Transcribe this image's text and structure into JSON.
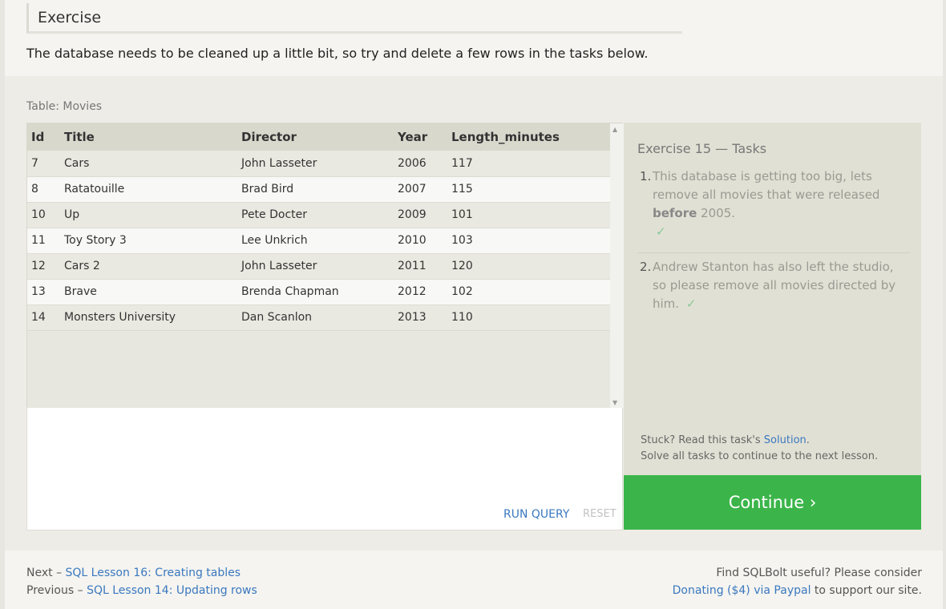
{
  "exercise": {
    "heading": "Exercise",
    "intro": "The database needs to be cleaned up a little bit, so try and delete a few rows in the tasks below."
  },
  "table": {
    "label": "Table: Movies",
    "columns": [
      "Id",
      "Title",
      "Director",
      "Year",
      "Length_minutes"
    ],
    "rows": [
      [
        "7",
        "Cars",
        "John Lasseter",
        "2006",
        "117"
      ],
      [
        "8",
        "Ratatouille",
        "Brad Bird",
        "2007",
        "115"
      ],
      [
        "10",
        "Up",
        "Pete Docter",
        "2009",
        "101"
      ],
      [
        "11",
        "Toy Story 3",
        "Lee Unkrich",
        "2010",
        "103"
      ],
      [
        "12",
        "Cars 2",
        "John Lasseter",
        "2011",
        "120"
      ],
      [
        "13",
        "Brave",
        "Brenda Chapman",
        "2012",
        "102"
      ],
      [
        "14",
        "Monsters University",
        "Dan Scanlon",
        "2013",
        "110"
      ]
    ]
  },
  "editor": {
    "run_label": "RUN QUERY",
    "reset_label": "RESET"
  },
  "tasks": {
    "title": "Exercise 15 — Tasks",
    "items": [
      {
        "number": "1.",
        "text_before": "This database is getting too big, lets remove all movies that were released ",
        "bold": "before",
        "text_after": " 2005.",
        "check": "✓"
      },
      {
        "number": "2.",
        "text": "Andrew Stanton has also left the studio, so please remove all movies directed by him.",
        "check": "✓"
      }
    ],
    "stuck_prefix": "Stuck? Read this task's ",
    "solution_label": "Solution",
    "stuck_suffix": ".",
    "solve_all": "Solve all tasks to continue to the next lesson.",
    "continue_label": "Continue ›"
  },
  "footer": {
    "next_prefix": "Next – ",
    "next_link": "SQL Lesson 16: Creating tables",
    "prev_prefix": "Previous – ",
    "prev_link": "SQL Lesson 14: Updating rows",
    "right_line1": "Find SQLBolt useful? Please consider",
    "donate_link": "Donating ($4) via Paypal",
    "right_line2_suffix": " to support our site."
  },
  "icons": {
    "scroll_up": "scroll-up-arrow-icon",
    "scroll_down": "scroll-down-arrow-icon",
    "check": "checkmark-icon"
  },
  "colors": {
    "continue_bg": "#3bb54a",
    "link": "#3a78bf"
  }
}
